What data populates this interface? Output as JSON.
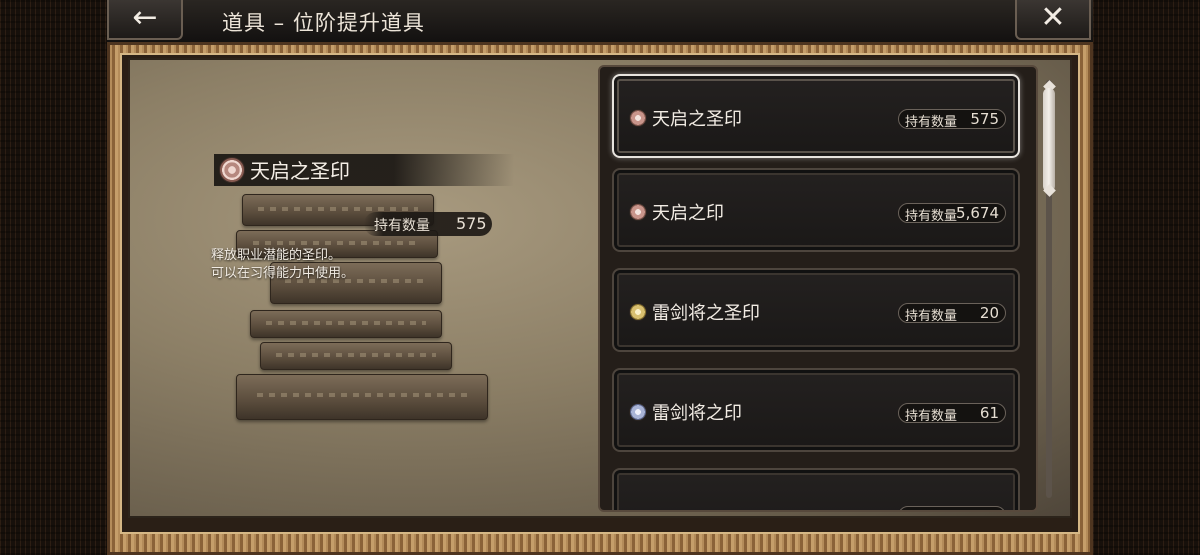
{
  "header": {
    "back_icon": "←",
    "title": "道具 – 位阶提升道具",
    "close_icon": "✕"
  },
  "detail": {
    "name": "天启之圣印",
    "count_label": "持有数量",
    "count_value": "575",
    "description_lines": [
      "释放职业潜能的圣印。",
      "可以在习得能力中使用。"
    ],
    "icon_color": "#c8948a"
  },
  "items": [
    {
      "name": "天启之圣印",
      "count_label": "持有数量",
      "count": "575",
      "icon_color": "#c9958b",
      "selected": true
    },
    {
      "name": "天启之印",
      "count_label": "持有数量",
      "count": "5,674",
      "icon_color": "#c9958b",
      "selected": false
    },
    {
      "name": "雷剑将之圣印",
      "count_label": "持有数量",
      "count": "20",
      "icon_color": "#d9c070",
      "selected": false
    },
    {
      "name": "雷剑将之印",
      "count_label": "持有数量",
      "count": "61",
      "icon_color": "#a9b4d6",
      "selected": false
    }
  ]
}
